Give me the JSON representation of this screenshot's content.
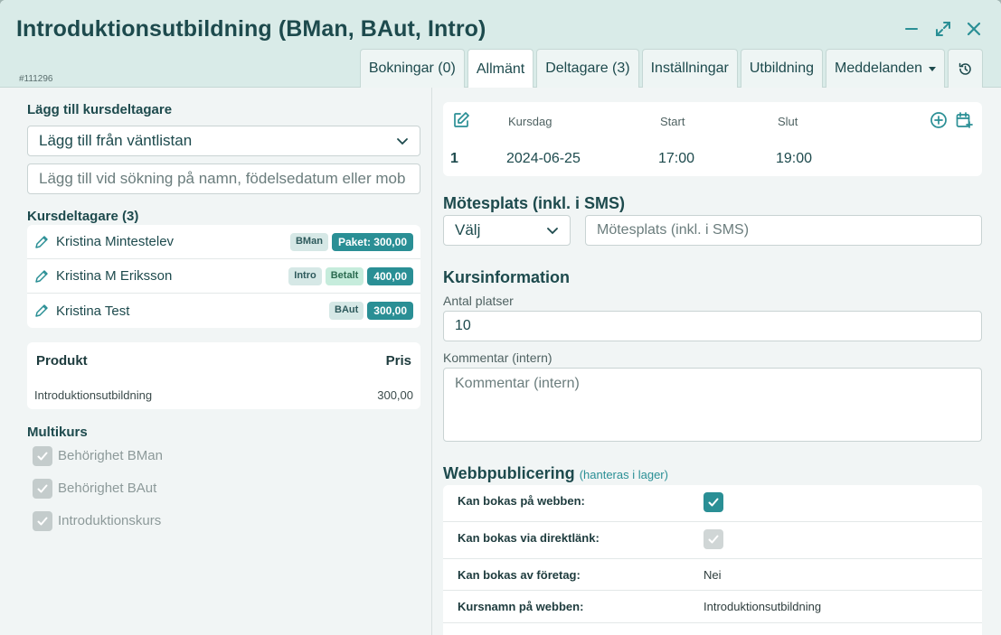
{
  "window": {
    "title": "Introduktionsutbildning (BMan, BAut, Intro)",
    "record_id": "#111296",
    "tabs": [
      {
        "label": "Bokningar (0)"
      },
      {
        "label": "Allmänt"
      },
      {
        "label": "Deltagare (3)"
      },
      {
        "label": "Inställningar"
      },
      {
        "label": "Utbildning"
      },
      {
        "label": "Meddelanden"
      }
    ],
    "icons": [
      "minimize-icon",
      "expand-icon",
      "close-icon",
      "history-icon"
    ]
  },
  "left": {
    "add_title": "Lägg till kursdeltagare",
    "waitlist_select": "Lägg till från väntlistan",
    "search_placeholder": "Lägg till vid sökning på namn, födelsedatum eller mob",
    "participants_title": "Kursdeltagare (3)",
    "participants": [
      {
        "name": "Kristina Mintestelev",
        "tags": [
          "BMan"
        ],
        "status": "",
        "price": "Paket: 300,00"
      },
      {
        "name": "Kristina M Eriksson",
        "tags": [
          "Intro"
        ],
        "status": "Betalt",
        "price": "400,00"
      },
      {
        "name": "Kristina Test",
        "tags": [
          "BAut"
        ],
        "status": "",
        "price": "300,00"
      }
    ],
    "product": {
      "col_product": "Produkt",
      "col_price": "Pris",
      "rows": [
        {
          "name": "Introduktionsutbildning",
          "price": "300,00"
        }
      ]
    },
    "multikurs_title": "Multikurs",
    "multikurs": [
      {
        "label": "Behörighet BMan",
        "checked": true
      },
      {
        "label": "Behörighet BAut",
        "checked": true
      },
      {
        "label": "Introduktionskurs",
        "checked": true
      }
    ]
  },
  "right": {
    "schedule": {
      "headers": {
        "day": "Kursdag",
        "start": "Start",
        "end": "Slut"
      },
      "rows": [
        {
          "num": "1",
          "date": "2024-06-25",
          "start": "17:00",
          "end": "19:00"
        }
      ]
    },
    "meeting_title": "Mötesplats (inkl. i SMS)",
    "meeting_select": "Välj",
    "meeting_placeholder": "Mötesplats (inkl. i SMS)",
    "course_info_title": "Kursinformation",
    "seats_label": "Antal platser",
    "seats_value": "10",
    "comment_label": "Kommentar (intern)",
    "comment_placeholder": "Kommentar (intern)",
    "web_title": "Webbpublicering",
    "web_note": "(hanteras i lager)",
    "web_rows": [
      {
        "key": "Kan bokas på webben:",
        "type": "check",
        "checked": true
      },
      {
        "key": "Kan bokas via direktlänk:",
        "type": "check",
        "checked": false
      },
      {
        "key": "Kan bokas av företag:",
        "type": "text",
        "value": "Nei"
      },
      {
        "key": "Kursnamn på webben:",
        "type": "text",
        "value": "Introduktionsutbildning"
      }
    ]
  },
  "colors": {
    "accent": "#2a8f95",
    "header_bg": "#d9ebe8",
    "title": "#1d4a4d"
  }
}
